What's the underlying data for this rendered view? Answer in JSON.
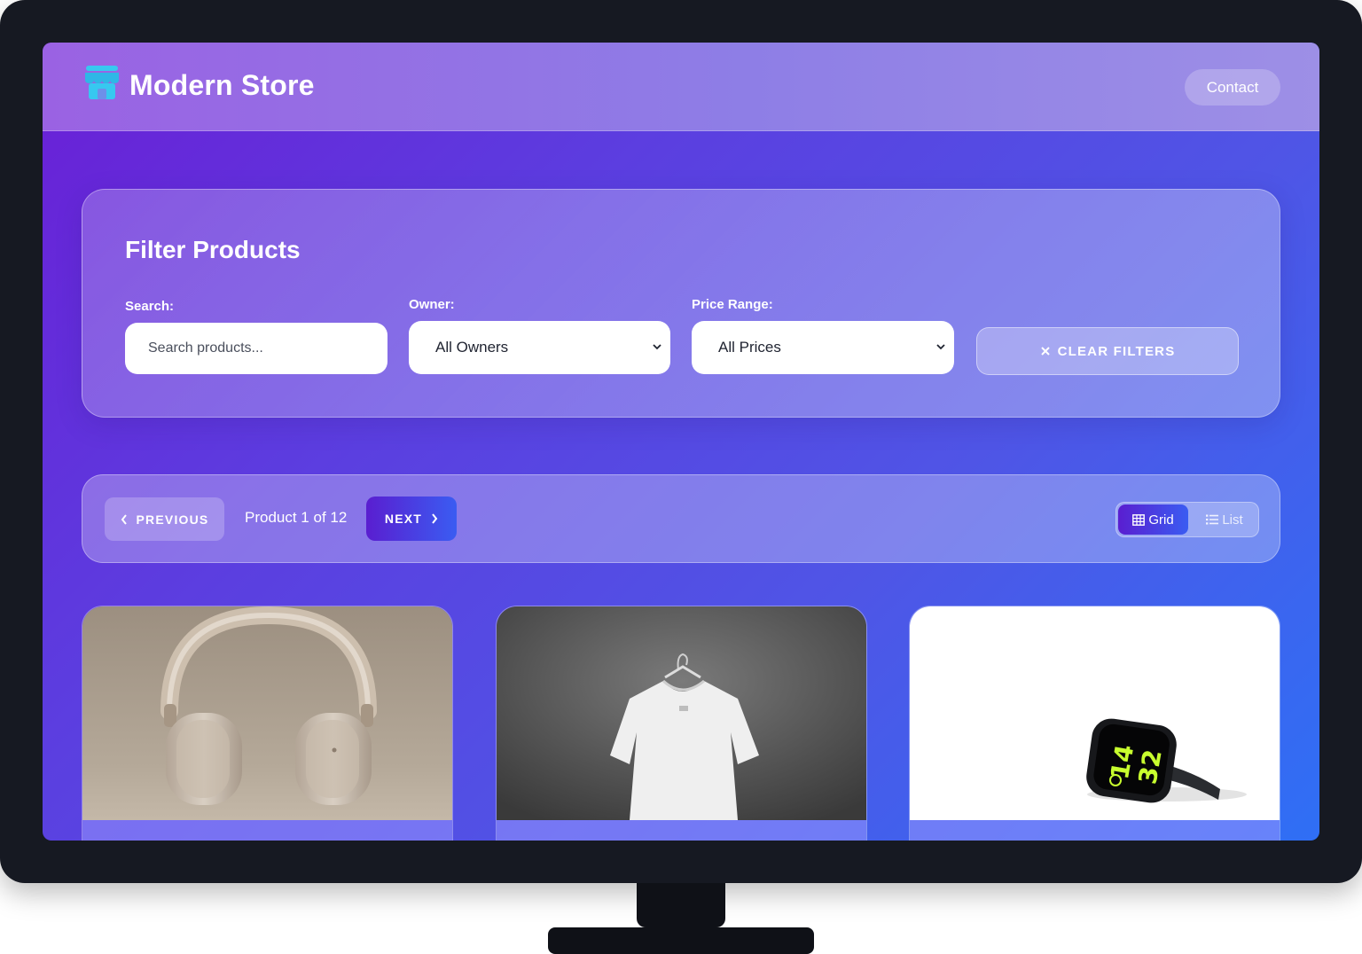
{
  "header": {
    "brand": "Modern Store",
    "contact_label": "Contact"
  },
  "filters": {
    "title": "Filter Products",
    "search_label": "Search:",
    "search_placeholder": "Search products...",
    "owner_label": "Owner:",
    "owner_selected": "All Owners",
    "price_label": "Price Range:",
    "price_selected": "All Prices",
    "clear_label": "CLEAR FILTERS"
  },
  "pagination": {
    "previous_label": "PREVIOUS",
    "indicator": "Product 1 of 12",
    "next_label": "NEXT"
  },
  "view_toggle": {
    "grid_label": "Grid",
    "list_label": "List",
    "active": "grid"
  },
  "products": [
    {
      "image": "headphones"
    },
    {
      "image": "white-t-shirt-on-hanger"
    },
    {
      "image": "smartwatch",
      "watch_time": [
        "14",
        "32"
      ]
    }
  ],
  "icons": {
    "logo": "store-icon",
    "clear": "close-icon",
    "previous": "chevron-left-icon",
    "next": "chevron-right-icon",
    "grid": "grid-icon",
    "list": "list-icon",
    "select": "chevron-down-icon"
  },
  "colors": {
    "logo_accent": "#37c8f0",
    "active_button": "#5a1ed0",
    "watch_digits": "#c8ff2e"
  }
}
